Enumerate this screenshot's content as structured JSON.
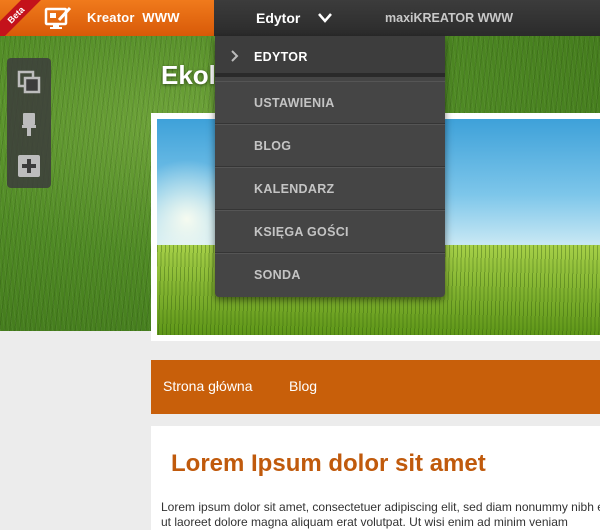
{
  "topbar": {
    "beta_label": "Beta",
    "brand_label": "Kreator  WWW",
    "menu_label": "Edytor",
    "maxi_label": "maxiKREATOR WWW"
  },
  "dropdown": {
    "items": [
      {
        "label": "EDYTOR",
        "active": true
      },
      {
        "label": "USTAWIENIA",
        "active": false
      },
      {
        "label": "BLOG",
        "active": false
      },
      {
        "label": "KALENDARZ",
        "active": false
      },
      {
        "label": "KSIĘGA GOŚCI",
        "active": false
      },
      {
        "label": "SONDA",
        "active": false
      }
    ]
  },
  "tools": [
    "copy-icon",
    "brush-icon",
    "add-icon"
  ],
  "site": {
    "title": "Ekol",
    "nav": [
      "Strona główna",
      "Blog"
    ],
    "content_title": "Lorem Ipsum dolor sit amet",
    "content_line1": "Lorem ipsum dolor sit amet, consectetuer adipiscing elit, sed diam nonummy nibh euismod",
    "content_line2": "ut laoreet dolore magna aliquam erat volutpat. Ut wisi enim ad minim veniam"
  },
  "colors": {
    "brand_orange": "#e46a10",
    "nav_orange": "#c85f0a",
    "title_orange": "#c05a0c",
    "topbar": "#333333",
    "dropdown_bg": "#454545"
  }
}
